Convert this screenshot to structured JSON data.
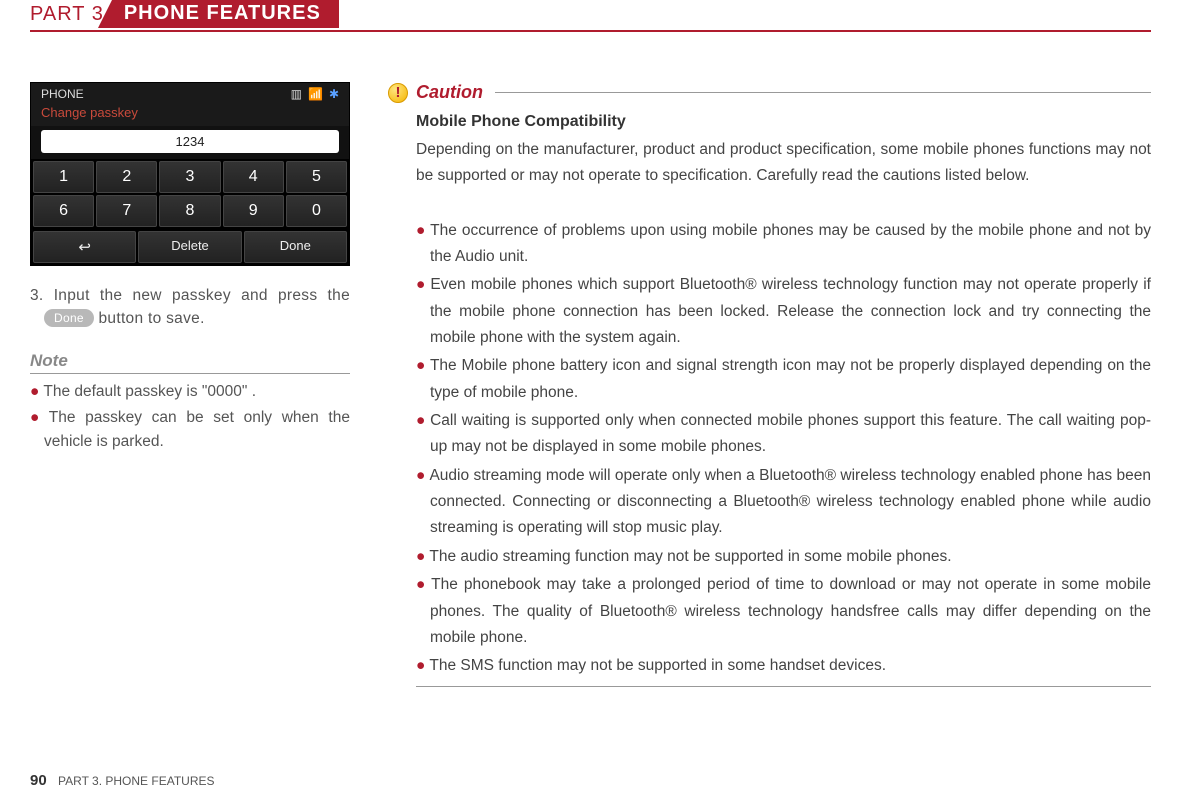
{
  "header": {
    "part": "PART 3",
    "title": "PHONE FEATURES"
  },
  "screenshot": {
    "title": "PHONE",
    "subtitle": "Change passkey",
    "input_value": "1234",
    "keys": [
      "1",
      "2",
      "3",
      "4",
      "5",
      "6",
      "7",
      "8",
      "9",
      "0"
    ],
    "back": "↩",
    "delete": "Delete",
    "done": "Done"
  },
  "step": {
    "num": "3.",
    "text_before": "Input the new passkey and press the ",
    "button": "Done",
    "text_after": " button to save."
  },
  "note": {
    "heading": "Note",
    "items": [
      "The default passkey is \"0000\" .",
      "The passkey can be set only when the vehicle is parked."
    ]
  },
  "caution": {
    "label": "Caution",
    "title": "Mobile Phone Compatibility",
    "intro": "Depending on the manufacturer, product and product specification, some mobile phones functions may not be supported or may not operate to specification. Carefully read the cautions listed below.",
    "bullets": [
      "The occurrence of problems upon using mobile phones may be caused by the mobile phone and not by the Audio unit.",
      "Even mobile phones which support Bluetooth® wireless technology function may not operate properly if the mobile phone connection has been locked. Release the connection lock and try connecting the mobile phone with the system again.",
      "The Mobile phone battery icon and signal strength icon may not be properly displayed depending on the type of mobile phone.",
      "Call waiting is supported only when connected mobile phones support this feature. The call waiting pop-up may not be displayed in some mobile phones.",
      "Audio streaming mode will operate only when a Bluetooth® wireless technology enabled phone has been connected. Connecting or disconnecting a Bluetooth® wireless technology enabled phone while audio streaming is operating will stop music play.",
      "The audio streaming function may not be supported in some mobile phones.",
      "The phonebook may take a prolonged period of time to download or may not operate in some mobile phones. The quality of Bluetooth® wireless technology handsfree calls may differ depending on the mobile phone.",
      "The SMS function may not be supported in some handset devices."
    ]
  },
  "footer": {
    "page": "90",
    "text": "PART 3. PHONE FEATURES"
  }
}
